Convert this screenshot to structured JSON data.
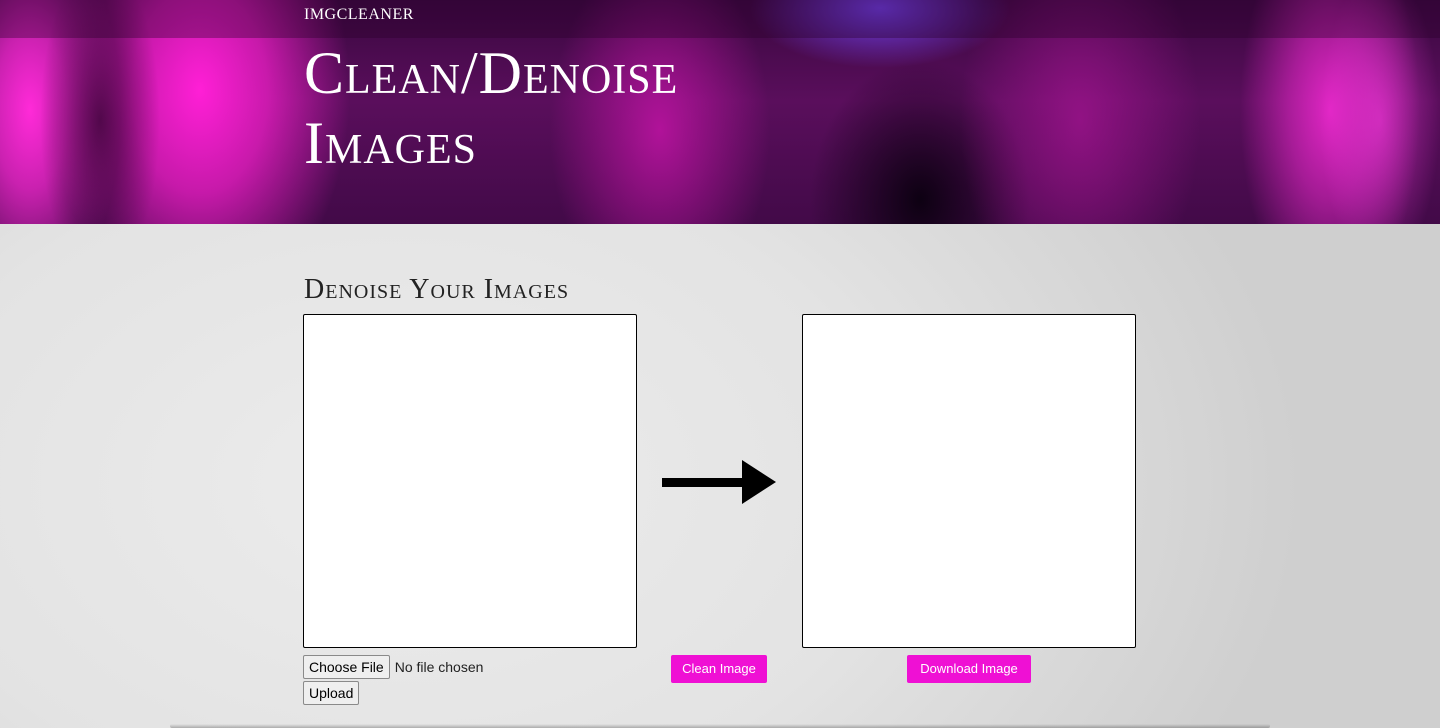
{
  "navbar": {
    "brand": "IMGCLEANER"
  },
  "hero": {
    "title_line1": "Clean/Denoise",
    "title_line2": "Images"
  },
  "main": {
    "section_title": "Denoise Your Images",
    "file_input": {
      "button_label": "Choose File",
      "status": "No file chosen"
    },
    "upload_label": "Upload",
    "clean_label": "Clean Image",
    "download_label": "Download Image",
    "arrow_icon": "right-arrow-icon"
  },
  "colors": {
    "accent": "#ef10d4",
    "hero_base": "#5a0e5c"
  }
}
